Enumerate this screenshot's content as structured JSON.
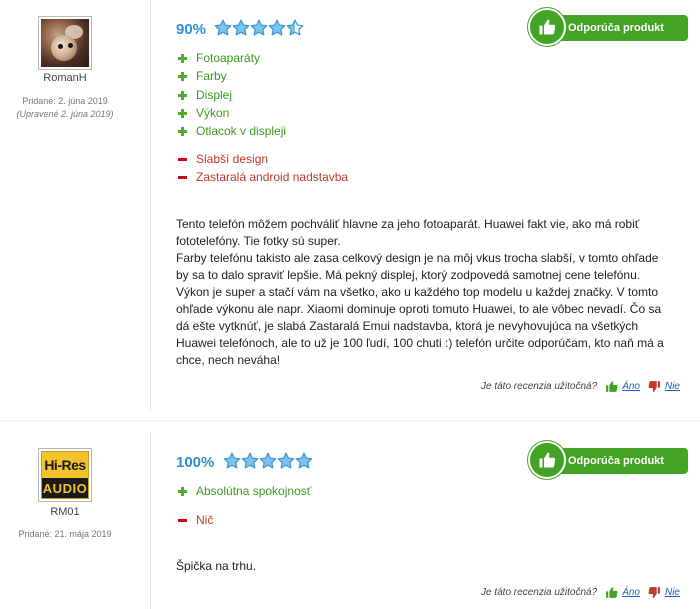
{
  "reviews": [
    {
      "username": "RomanH",
      "date_added": "Pridané: 2. júna 2019",
      "date_edited": "(Upravené 2. júna 2019)",
      "score": "90%",
      "rating_stars": 4.5,
      "recommend_label": "Odporúča produkt",
      "pros": [
        "Fotoaparáty",
        "Farby",
        "Displej",
        "Výkon",
        "Otlacok v displeji"
      ],
      "cons": [
        "Slabší design",
        "Zastaralá android nadstavba"
      ],
      "body": [
        "Tento telefón môžem pochváliť hlavne za jeho fotoaparát. Huawei fakt vie, ako má robiť fototelefóny. Tie fotky sú super.",
        "Farby telefónu takisto ale zasa celkový design je na môj vkus trocha slabší, v tomto ohľade by sa to dalo spraviť lepšie. Má pekný displej, ktorý zodpovedá samotnej cene telefónu. Výkon je super a stačí vám na všetko, ako u každého top modelu u každej značky. V tomto ohľade výkonu ale napr. Xiaomi dominuje oproti tomuto Huawei, to ale vôbec nevadí. Čo sa dá ešte vytknúť, je slabá Zastaralá Emui nadstavba, ktorá je nevyhovujúca na všetkých Huawei telefónoch, ale to už je 100 ľudí, 100 chuti :) telefón určite odporúčam, kto naň má a chce, nech neváha!"
      ],
      "useful_question": "Je táto recenzia užitočná?",
      "yes_label": "Áno",
      "no_label": "Nie"
    },
    {
      "username": "RM01",
      "avatar_top": "Hi-Res",
      "avatar_bottom": "AUDIO",
      "date_added": "Pridané: 21. mája 2019",
      "score": "100%",
      "rating_stars": 5,
      "recommend_label": "Odporúča produkt",
      "pros": [
        "Absolútna spokojnosť"
      ],
      "cons": [
        "Nič"
      ],
      "body": [
        "Špička na trhu."
      ],
      "useful_question": "Je táto recenzia užitočná?",
      "yes_label": "Áno",
      "no_label": "Nie"
    }
  ],
  "colors": {
    "score": "#2e8fd6",
    "star_fill": "#7fc3ec",
    "star_stroke": "#3d9bd7",
    "recommend_bg": "#43a325",
    "pro_text": "#3b9a1f",
    "con_text": "#c0392b",
    "link": "#1f5fb5"
  }
}
